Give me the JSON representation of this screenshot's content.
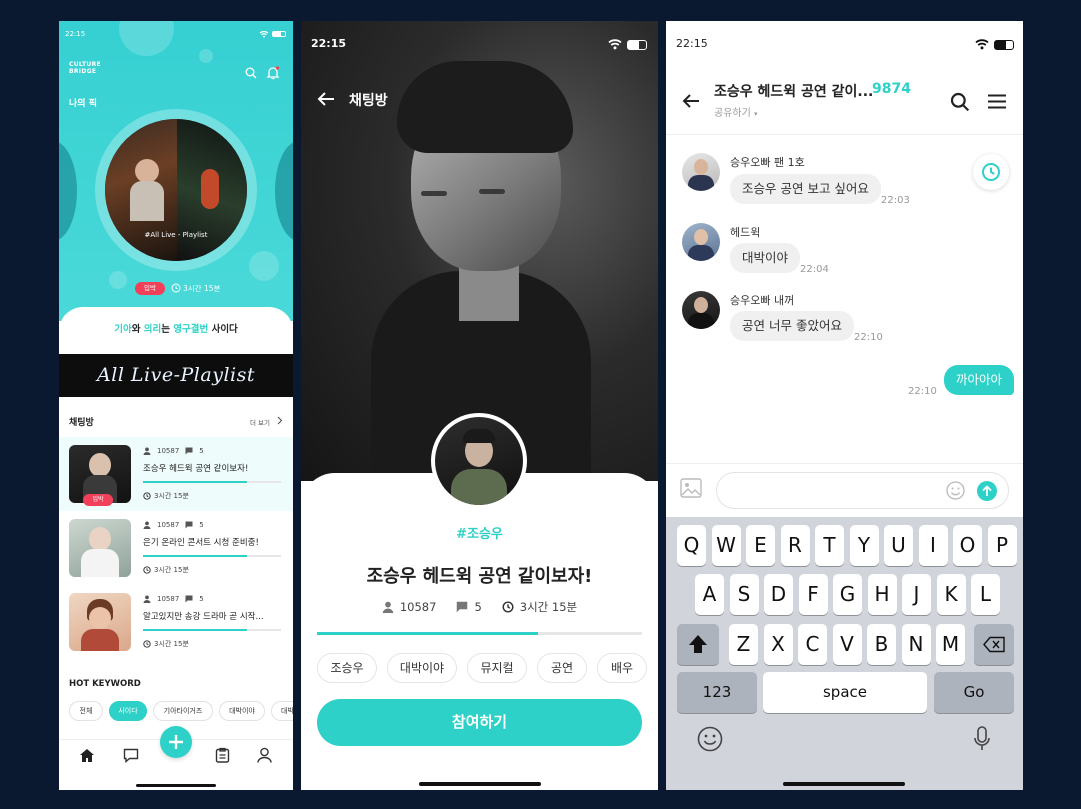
{
  "status_time": "22:15",
  "phone1": {
    "logo_lines": [
      "CULTURE",
      "BRIDGE"
    ],
    "section_label": "나의 픽",
    "playlist_label": "#All Live - Playlist",
    "entry_badge": "입박",
    "timer": "3시간 15분",
    "banner": {
      "p1": "기아",
      "p2": "와 ",
      "p3": "의리",
      "p4": "는 ",
      "p5": "영구결번",
      "p6": " 사이다"
    },
    "script_banner": "All Live-Playlist",
    "chat_header": "채팅방",
    "more_link": "더 보기",
    "rooms": [
      {
        "members": "10587",
        "comments": "5",
        "title": "조승우 헤드윅 공연 같이보자!",
        "time": "3시간 15분",
        "badge": "입박",
        "progress": 0.75
      },
      {
        "members": "10587",
        "comments": "5",
        "title": "은기 온라인 콘서트 시청 준비중!",
        "time": "3시간 15분",
        "badge": "",
        "progress": 0.75
      },
      {
        "members": "10587",
        "comments": "5",
        "title": "알고있지만 송강 드라마 곧 시작...",
        "time": "3시간 15분",
        "badge": "",
        "progress": 0.75
      }
    ],
    "hot_keyword_title": "HOT KEYWORD",
    "keywords": [
      "전체",
      "사이다",
      "기아타이거즈",
      "대박이야",
      "대박"
    ],
    "active_keyword": "사이다"
  },
  "phone2": {
    "header_title": "채팅방",
    "hashtag": "#조승우",
    "room_title": "조승우 헤드윅 공연 같이보자!",
    "members": "10587",
    "comments": "5",
    "time": "3시간 15분",
    "progress": 0.68,
    "tags": [
      "조승우",
      "대박이야",
      "뮤지컬",
      "공연",
      "배우"
    ],
    "join_button": "참여하기"
  },
  "phone3": {
    "title": "조승우 헤드윅 공연 같이...",
    "count": "9874",
    "share": "공유하기",
    "messages": [
      {
        "name": "승우오빠 팬 1호",
        "text": "조승우 공연 보고 싶어요",
        "time": "22:03"
      },
      {
        "name": "헤드윅",
        "text": "대박이야",
        "time": "22:04"
      },
      {
        "name": "승우오빠 내꺼",
        "text": "공연 너무 좋았어요",
        "time": "22:10"
      }
    ],
    "my_message": {
      "text": "까아아아",
      "time": "22:10"
    },
    "keyboard": {
      "row1": [
        "Q",
        "W",
        "E",
        "R",
        "T",
        "Y",
        "U",
        "I",
        "O",
        "P"
      ],
      "row2": [
        "A",
        "S",
        "D",
        "F",
        "G",
        "H",
        "J",
        "K",
        "L"
      ],
      "row3": [
        "Z",
        "X",
        "C",
        "V",
        "B",
        "N",
        "M"
      ],
      "num": "123",
      "space": "space",
      "go": "Go"
    }
  },
  "colors": {
    "accent": "#2ed1c7",
    "background": "#0b1930",
    "badge": "#f2405a"
  }
}
